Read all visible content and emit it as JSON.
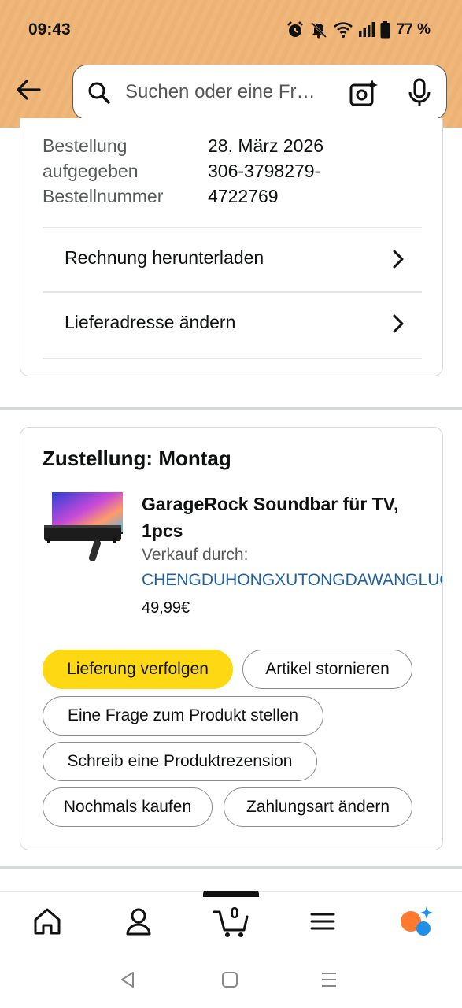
{
  "status_bar": {
    "time": "09:43",
    "battery": "77 %"
  },
  "search": {
    "placeholder": "Suchen oder eine Fr…"
  },
  "order_info": {
    "rows": [
      {
        "label": "Bestellung",
        "value": "28. März 2026"
      },
      {
        "label": "aufgegeben",
        "value": "306-3798279-"
      },
      {
        "label": "Bestellnummer",
        "value": "4722769"
      }
    ],
    "links": [
      {
        "label": "Rechnung herunterladen"
      },
      {
        "label": "Lieferadresse ändern"
      }
    ]
  },
  "delivery": {
    "title": "Zustellung: Montag",
    "product": {
      "title": "GarageRock Soundbar für TV, 1pcs",
      "sold_by_label": "Verkauf durch:",
      "seller": "CHENGDUHONGXUTONGDAWANGLUOKEJIYOUXIANGONGSI",
      "price": "49,99€"
    },
    "actions": [
      {
        "label": "Lieferung verfolgen",
        "primary": true
      },
      {
        "label": "Artikel stornieren"
      },
      {
        "label": "Eine Frage zum Produkt stellen"
      },
      {
        "label": "Schreib eine Produktrezension"
      },
      {
        "label": "Nochmals kaufen"
      },
      {
        "label": "Zahlungsart ändern"
      }
    ]
  },
  "bottom_nav": {
    "items": [
      "home-icon",
      "account-icon",
      "cart-icon",
      "menu-icon",
      "rufus-icon"
    ],
    "cart_count": "0"
  },
  "colors": {
    "header_bg": "#f0b77a",
    "primary_button": "#ffd814",
    "link": "#2162a1"
  }
}
